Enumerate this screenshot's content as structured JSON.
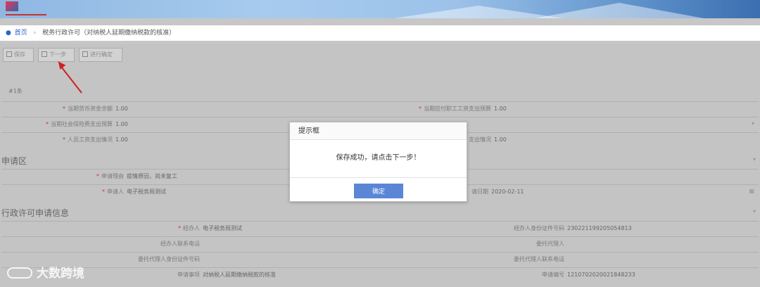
{
  "breadcrumb": {
    "home": "首页",
    "separator": "›",
    "current": "税务行政许可（对纳税人延期缴纳税款的核准）"
  },
  "toolbar": {
    "save": "保存",
    "next": "下一步",
    "assoc": "进行确定"
  },
  "sub_header": "#1条",
  "fields_top": [
    {
      "label": "当期货币资金余额",
      "value": "1.00"
    },
    {
      "label": "当期应付职工工资支出预算",
      "value": "1.00"
    },
    {
      "label": "当期社会保险费支出预算",
      "value": "1.00"
    },
    {
      "label": "人员工资支出情况",
      "value": "1.00"
    },
    {
      "label": "支出情况",
      "value": "1.00"
    }
  ],
  "section_apply": "申请区",
  "fields_apply": [
    {
      "label": "申请理由",
      "value": "疫情原因，尚未复工"
    },
    {
      "label": "申请人",
      "value": "电子税务局测试"
    },
    {
      "label": "请日期",
      "value": "2020-02-11"
    }
  ],
  "section_permit": "行政许可申请信息",
  "fields_permit": [
    {
      "label": "经办人",
      "value": "电子税务局测试"
    },
    {
      "label": "经办人身份证件号码",
      "value": "230221199205054813"
    },
    {
      "label": "经办人联系电话",
      "value": ""
    },
    {
      "label": "委托代理人",
      "value": ""
    },
    {
      "label": "委托代理人身份证件号码",
      "value": ""
    },
    {
      "label": "委托代理人联系电话",
      "value": ""
    },
    {
      "label": "申请事项",
      "value": "对纳税人延期缴纳税款的核准"
    },
    {
      "label": "申请编号",
      "value": "12107020200218482​33"
    }
  ],
  "dialog": {
    "title": "提示框",
    "message": "保存成功，请点击下一步！",
    "ok": "确定"
  },
  "watermark": "大数跨境"
}
